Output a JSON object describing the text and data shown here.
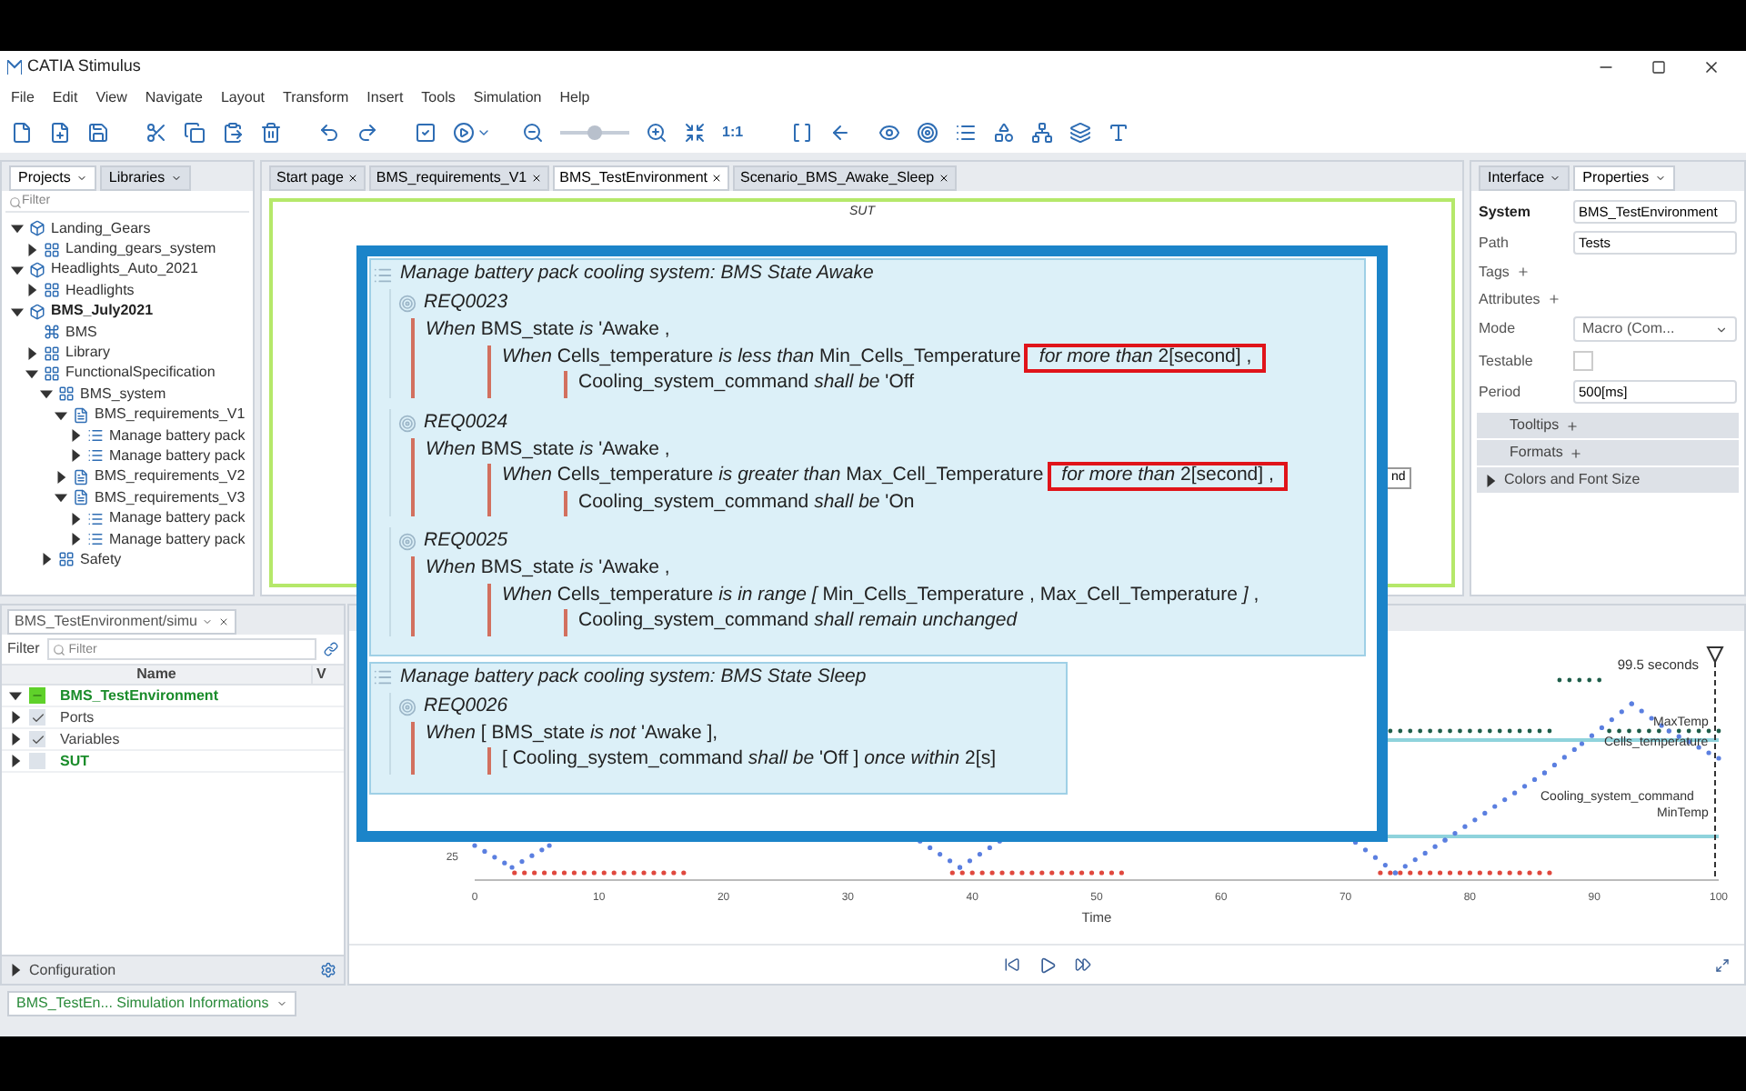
{
  "window": {
    "title": "CATIA Stimulus"
  },
  "menu": [
    "File",
    "Edit",
    "View",
    "Navigate",
    "Layout",
    "Transform",
    "Insert",
    "Tools",
    "Simulation",
    "Help"
  ],
  "toolbar": {
    "zoom": {
      "level": 0.5
    },
    "scale_label": "1:1"
  },
  "left_panel": {
    "tabs": [
      {
        "label": "Projects",
        "selected": true
      },
      {
        "label": "Libraries",
        "selected": false
      }
    ],
    "filter_placeholder": "Filter",
    "tree": [
      {
        "label": "Landing_Gears",
        "kind": "project",
        "expanded": true,
        "children": [
          {
            "label": "Landing_gears_system",
            "kind": "package",
            "expanded": false
          }
        ]
      },
      {
        "label": "Headlights_Auto_2021",
        "kind": "project",
        "expanded": true,
        "children": [
          {
            "label": "Headlights",
            "kind": "package",
            "expanded": false
          }
        ]
      },
      {
        "label": "BMS_July2021",
        "kind": "project",
        "expanded": true,
        "bold": true,
        "children": [
          {
            "label": "BMS",
            "kind": "model"
          },
          {
            "label": "Library",
            "kind": "package",
            "expanded": false
          },
          {
            "label": "FunctionalSpecification",
            "kind": "package",
            "expanded": true,
            "children": [
              {
                "label": "BMS_system",
                "kind": "package",
                "expanded": true,
                "children": [
                  {
                    "label": "BMS_requirements_V1",
                    "kind": "requirements",
                    "expanded": true,
                    "children": [
                      {
                        "label": "Manage battery pack",
                        "kind": "list",
                        "expanded": false
                      },
                      {
                        "label": "Manage battery pack",
                        "kind": "list",
                        "expanded": false
                      }
                    ]
                  },
                  {
                    "label": "BMS_requirements_V2",
                    "kind": "requirements",
                    "expanded": false
                  },
                  {
                    "label": "BMS_requirements_V3",
                    "kind": "requirements",
                    "expanded": true,
                    "children": [
                      {
                        "label": "Manage battery pack",
                        "kind": "list",
                        "expanded": false
                      },
                      {
                        "label": "Manage battery pack",
                        "kind": "list",
                        "expanded": false
                      }
                    ]
                  }
                ]
              },
              {
                "label": "Safety",
                "kind": "package",
                "expanded": false
              }
            ]
          }
        ]
      }
    ]
  },
  "editor": {
    "tabs": [
      {
        "label": "Start page",
        "selected": false
      },
      {
        "label": "BMS_requirements_V1",
        "selected": false
      },
      {
        "label": "BMS_TestEnvironment",
        "selected": true
      },
      {
        "label": "Scenario_BMS_Awake_Sleep",
        "selected": false
      }
    ],
    "title": "SUT",
    "hidden_block_text": "nd"
  },
  "properties": {
    "tabs": [
      {
        "label": "Interface",
        "selected": false
      },
      {
        "label": "Properties",
        "selected": true
      }
    ],
    "rows": [
      {
        "kind": "title_field",
        "label": "System",
        "value": "BMS_TestEnvironment"
      },
      {
        "kind": "field",
        "label": "Path",
        "value": "Tests"
      },
      {
        "kind": "add",
        "label": "Tags"
      },
      {
        "kind": "add",
        "label": "Attributes"
      },
      {
        "kind": "select",
        "label": "Mode",
        "value": "Macro (Com..."
      },
      {
        "kind": "checkbox",
        "label": "Testable",
        "checked": false
      },
      {
        "kind": "field",
        "label": "Period",
        "value": "500[ms]"
      }
    ],
    "sections": [
      {
        "kind": "add",
        "label": "Tooltips"
      },
      {
        "kind": "add",
        "label": "Formats"
      },
      {
        "kind": "group",
        "label": "Colors and Font Size",
        "expanded": false
      }
    ]
  },
  "popup": {
    "groups": [
      {
        "title": "Manage battery pack cooling system: BMS State Awake",
        "requirements": [
          {
            "id": "REQ0023",
            "lines": [
              {
                "text": "*When*  BMS_state  *is*  'Awake ,",
                "children": [
                  {
                    "text": "*When*  Cells_temperature  *is less than*  Min_Cells_Temperature",
                    "boxed": "*for more than*  2[second]  ,",
                    "children": [
                      {
                        "text": "Cooling_system_command  *shall be*  'Off"
                      }
                    ]
                  }
                ]
              }
            ]
          },
          {
            "id": "REQ0024",
            "lines": [
              {
                "text": "*When*  BMS_state  *is*  'Awake ,",
                "children": [
                  {
                    "text": "*When*  Cells_temperature  *is greater than*  Max_Cell_Temperature",
                    "boxed": "*for more than*  2[second]  ,",
                    "children": [
                      {
                        "text": "Cooling_system_command  *shall be*  'On"
                      }
                    ]
                  }
                ]
              }
            ]
          },
          {
            "id": "REQ0025",
            "lines": [
              {
                "text": "*When*  BMS_state  *is*  'Awake ,",
                "children": [
                  {
                    "text": "*When*  Cells_temperature  *is in range [*  Min_Cells_Temperature ,  Max_Cell_Temperature *]* ,",
                    "children": [
                      {
                        "text": "Cooling_system_command  *shall remain unchanged*"
                      }
                    ]
                  }
                ]
              }
            ]
          }
        ]
      },
      {
        "title": "Manage battery pack cooling system: BMS State Sleep",
        "requirements": [
          {
            "id": "REQ0026",
            "lines": [
              {
                "text": "*When* [ BMS_state  *is not*  'Awake ],",
                "children": [
                  {
                    "text": "[ Cooling_system_command  *shall be*  'Off ] *once within*  2[s]"
                  }
                ]
              }
            ]
          }
        ]
      }
    ]
  },
  "simulation_panel": {
    "tab": "BMS_TestEnvironment/simu",
    "filter_label": "Filter",
    "filter_placeholder": "Filter",
    "columns": [
      "Name",
      "V"
    ],
    "rows": [
      {
        "label": "BMS_TestEnvironment",
        "partial": true,
        "expanded": true,
        "bold": true,
        "children": [
          {
            "label": "Ports",
            "checked": true,
            "expanded": false,
            "bold": false
          },
          {
            "label": "Variables",
            "checked": true,
            "expanded": false,
            "bold": false
          },
          {
            "label": "SUT",
            "checked": false,
            "expanded": false,
            "bold": true
          }
        ]
      }
    ],
    "configuration": {
      "label": "Configuration",
      "expanded": false
    }
  },
  "chart": {
    "marker_label": "99.5 seconds",
    "y_tick": "25",
    "x_ticks": [
      "0",
      "10",
      "20",
      "30",
      "40",
      "50",
      "60",
      "70",
      "80",
      "90",
      "100"
    ],
    "xlabel": "Time",
    "series_labels": [
      "MaxTemp",
      "Cells_temperature",
      "Cooling_system_command",
      "MinTemp"
    ]
  },
  "status_bar": {
    "tab": "BMS_TestEn... Simulation Informations"
  }
}
